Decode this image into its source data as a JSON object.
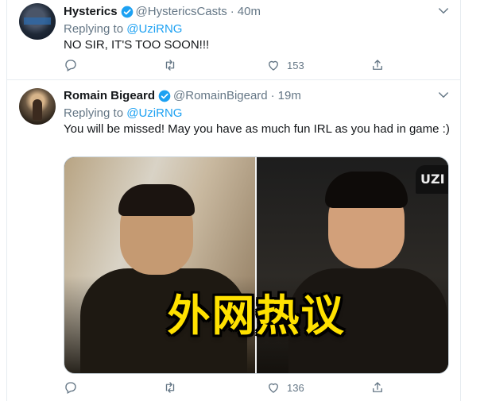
{
  "colors": {
    "accent": "#1da1f2",
    "muted": "#657786",
    "text": "#14171a",
    "border": "#e6ecf0",
    "overlay_text": "#ffe100"
  },
  "tweets": [
    {
      "name": "Hysterics",
      "handle": "@HystericsCasts",
      "separator": "·",
      "time": "40m",
      "replying_label": "Replying to",
      "replying_to": "@UziRNG",
      "text": "NO SIR, IT'S TOO SOON!!!",
      "like_count": "153"
    },
    {
      "name": "Romain Bigeard",
      "handle": "@RomainBigeard",
      "separator": "·",
      "time": "19m",
      "replying_label": "Replying to",
      "replying_to": "@UziRNG",
      "text": "You will be missed! May you have as much fun IRL as you had in game :)",
      "like_count": "136",
      "media": {
        "overlay_text": "外网热议",
        "cap_logo": "UZI"
      }
    }
  ],
  "icons": [
    "verified-badge-icon",
    "chevron-down-icon",
    "reply-icon",
    "retweet-icon",
    "like-icon",
    "share-icon"
  ]
}
